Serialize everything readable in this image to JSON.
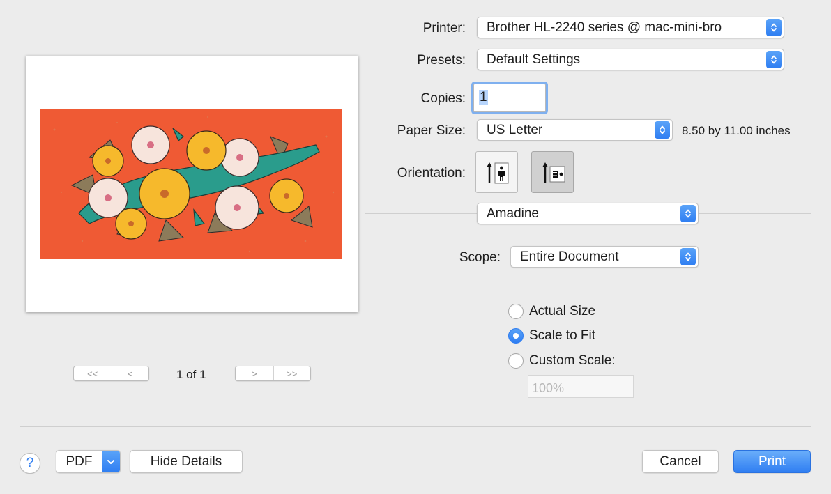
{
  "preview": {
    "page_counter": "1 of 1",
    "nav": {
      "first_glyph": "<<",
      "prev_glyph": "<",
      "next_glyph": ">",
      "last_glyph": ">>"
    }
  },
  "printer": {
    "label": "Printer:",
    "value": "Brother HL-2240 series @ mac-mini-bro"
  },
  "presets": {
    "label": "Presets:",
    "value": "Default Settings"
  },
  "copies": {
    "label": "Copies:",
    "value": "1"
  },
  "paper_size": {
    "label": "Paper Size:",
    "value": "US Letter",
    "description": "8.50 by 11.00 inches"
  },
  "orientation": {
    "label": "Orientation:",
    "selected": "landscape"
  },
  "app_section": {
    "value": "Amadine"
  },
  "scope": {
    "label": "Scope:",
    "value": "Entire Document"
  },
  "scaling": {
    "options": [
      {
        "label": "Actual Size",
        "checked": false
      },
      {
        "label": "Scale to Fit",
        "checked": true
      },
      {
        "label": "Custom Scale:",
        "checked": false
      }
    ],
    "custom_placeholder": "100%"
  },
  "footer": {
    "help_label": "?",
    "pdf_label": "PDF",
    "hide_details_label": "Hide Details",
    "cancel_label": "Cancel",
    "print_label": "Print"
  },
  "colors": {
    "accent": "#2f7ef2",
    "artwork_background": "#ef5a34",
    "alligator": "#2a9c8c",
    "hibiscus_yellow": "#f6b92c",
    "hibiscus_white": "#f7e4dc",
    "leaf": "#8c7b5a"
  }
}
